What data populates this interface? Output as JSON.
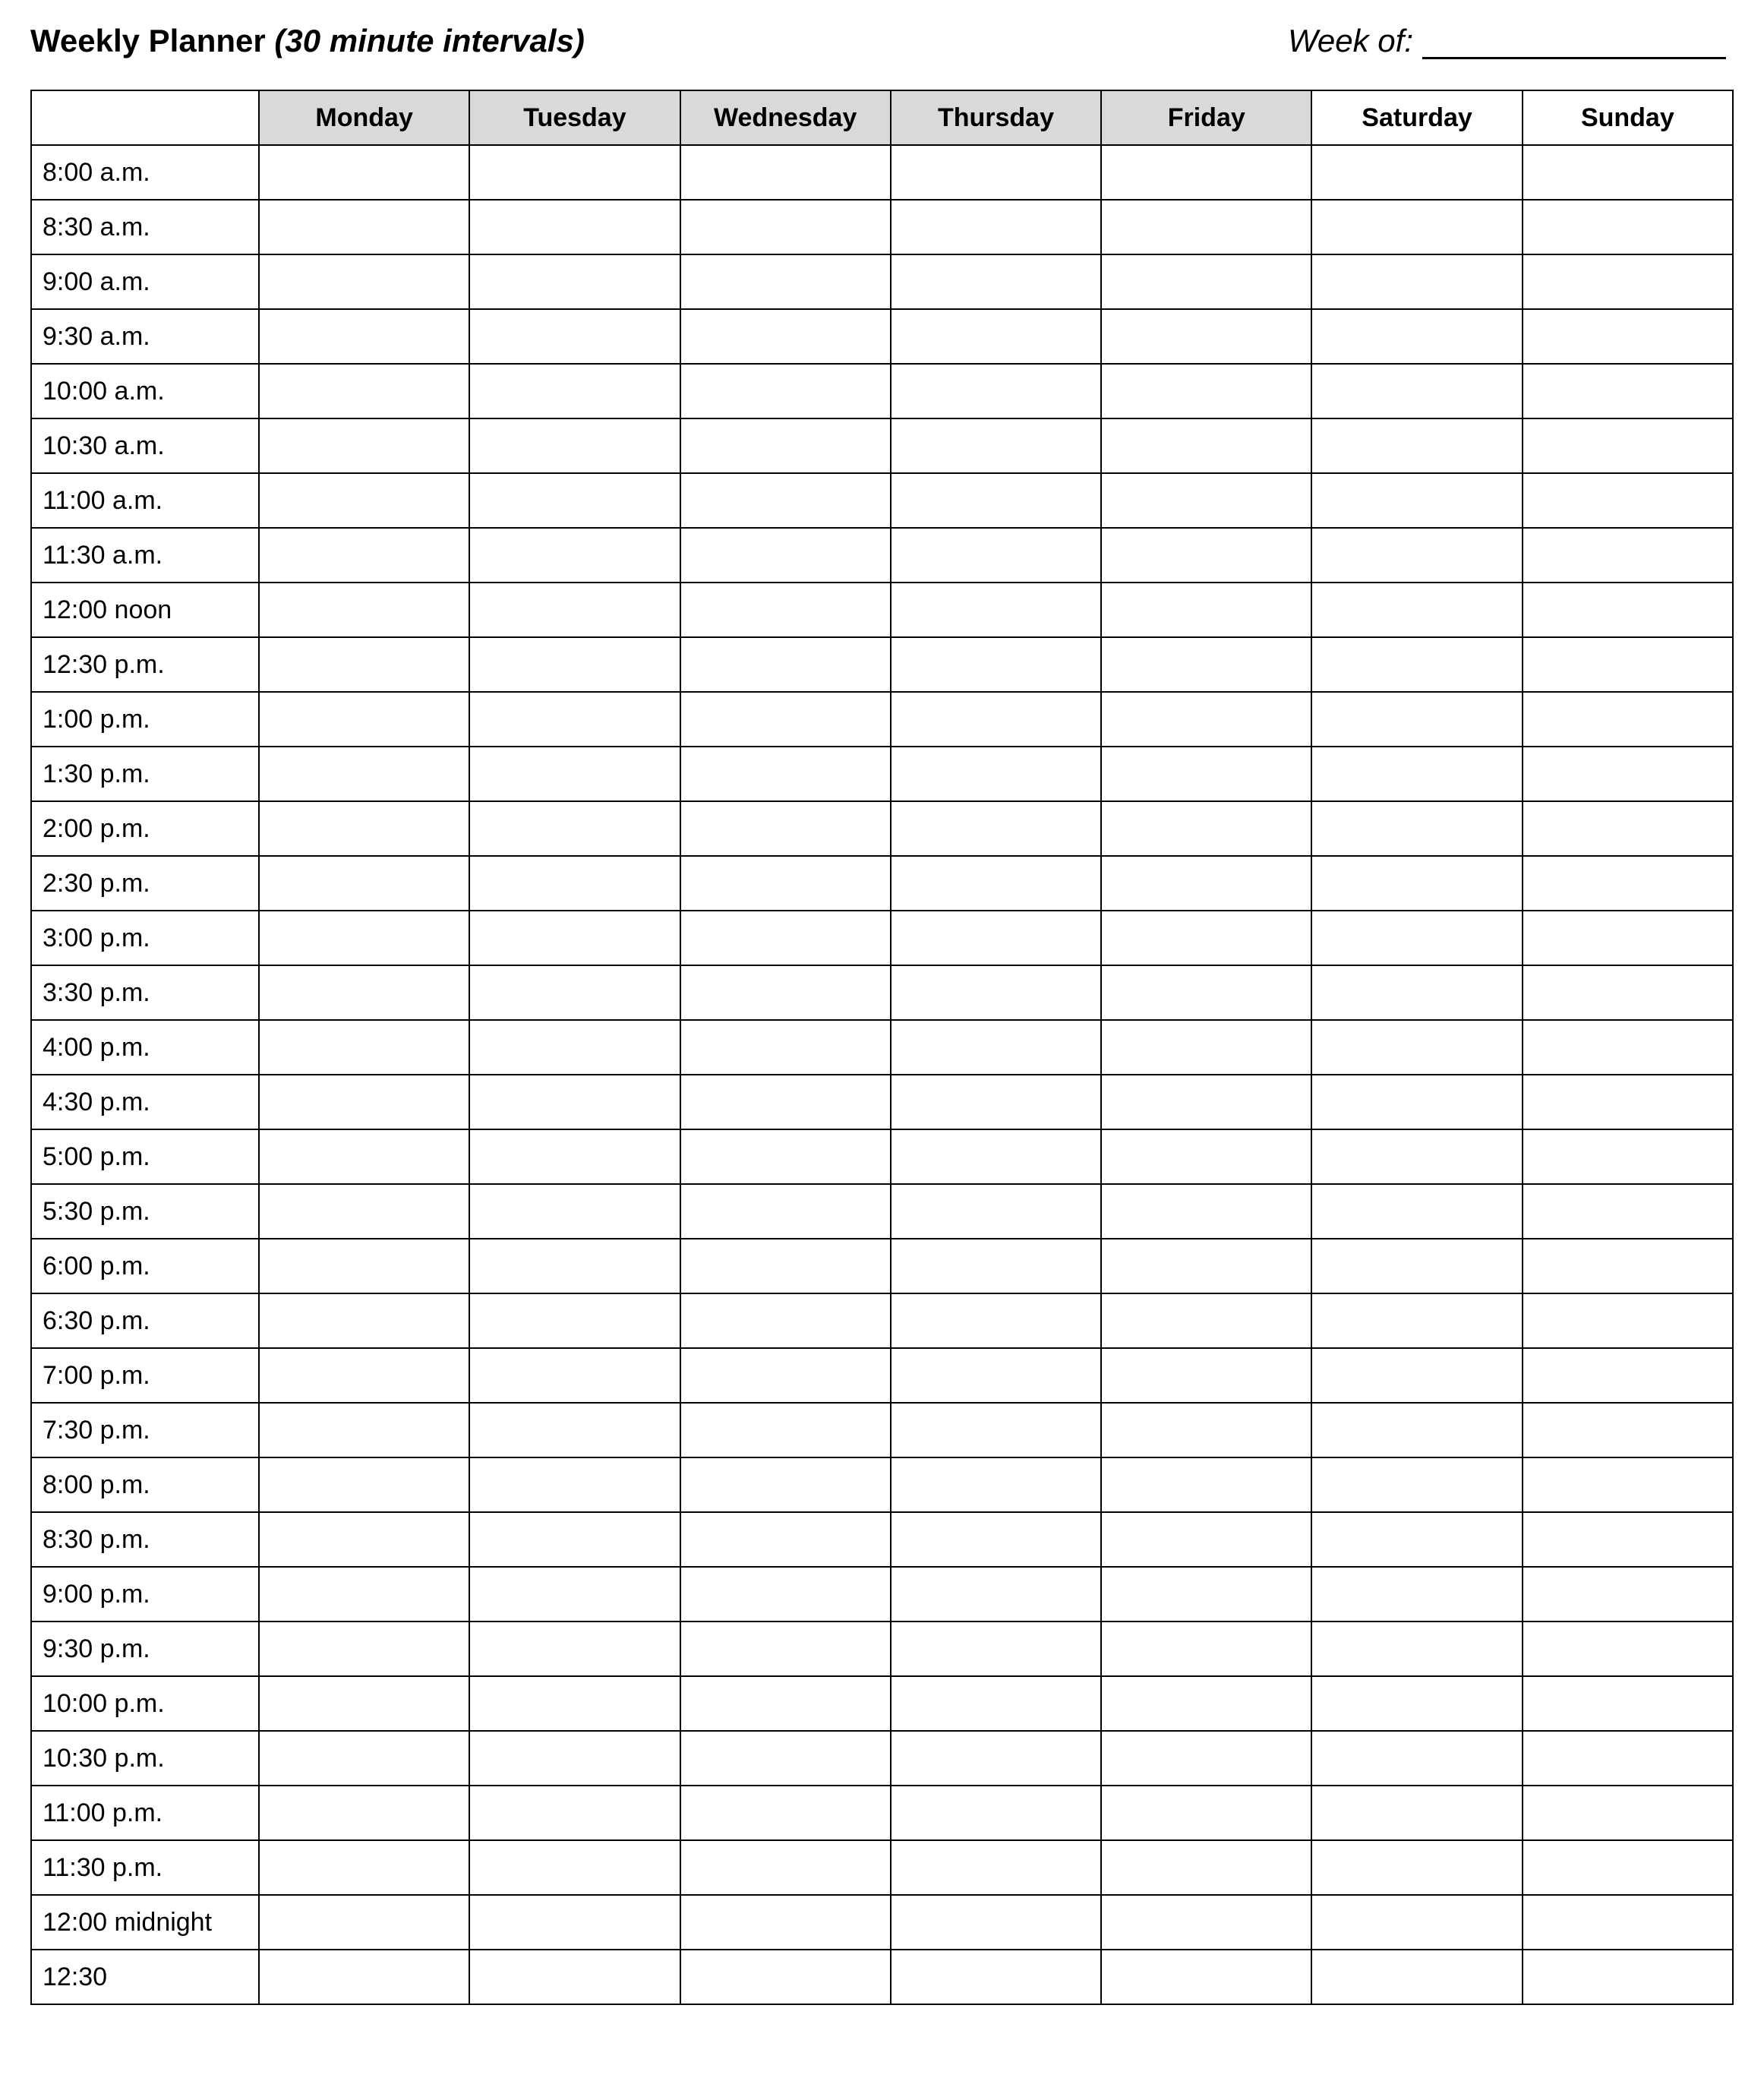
{
  "header": {
    "title_main": "Weekly Planner",
    "title_sub": "(30 minute intervals)",
    "week_of_label": "Week of:",
    "week_of_value": ""
  },
  "days": [
    {
      "label": "Monday",
      "shaded": true
    },
    {
      "label": "Tuesday",
      "shaded": true
    },
    {
      "label": "Wednesday",
      "shaded": true
    },
    {
      "label": "Thursday",
      "shaded": true
    },
    {
      "label": "Friday",
      "shaded": true
    },
    {
      "label": "Saturday",
      "shaded": false
    },
    {
      "label": "Sunday",
      "shaded": false
    }
  ],
  "times": [
    "8:00 a.m.",
    "8:30 a.m.",
    "9:00 a.m.",
    "9:30 a.m.",
    "10:00 a.m.",
    "10:30 a.m.",
    "11:00 a.m.",
    "11:30 a.m.",
    "12:00 noon",
    "12:30 p.m.",
    "1:00 p.m.",
    "1:30 p.m.",
    "2:00 p.m.",
    "2:30 p.m.",
    "3:00 p.m.",
    "3:30 p.m.",
    "4:00 p.m.",
    "4:30 p.m.",
    "5:00 p.m.",
    "5:30 p.m.",
    "6:00 p.m.",
    "6:30 p.m.",
    "7:00 p.m.",
    "7:30 p.m.",
    "8:00 p.m.",
    "8:30 p.m.",
    "9:00 p.m.",
    "9:30 p.m.",
    "10:00 p.m.",
    "10:30 p.m.",
    "11:00 p.m.",
    "11:30 p.m.",
    "12:00 midnight",
    "12:30"
  ]
}
